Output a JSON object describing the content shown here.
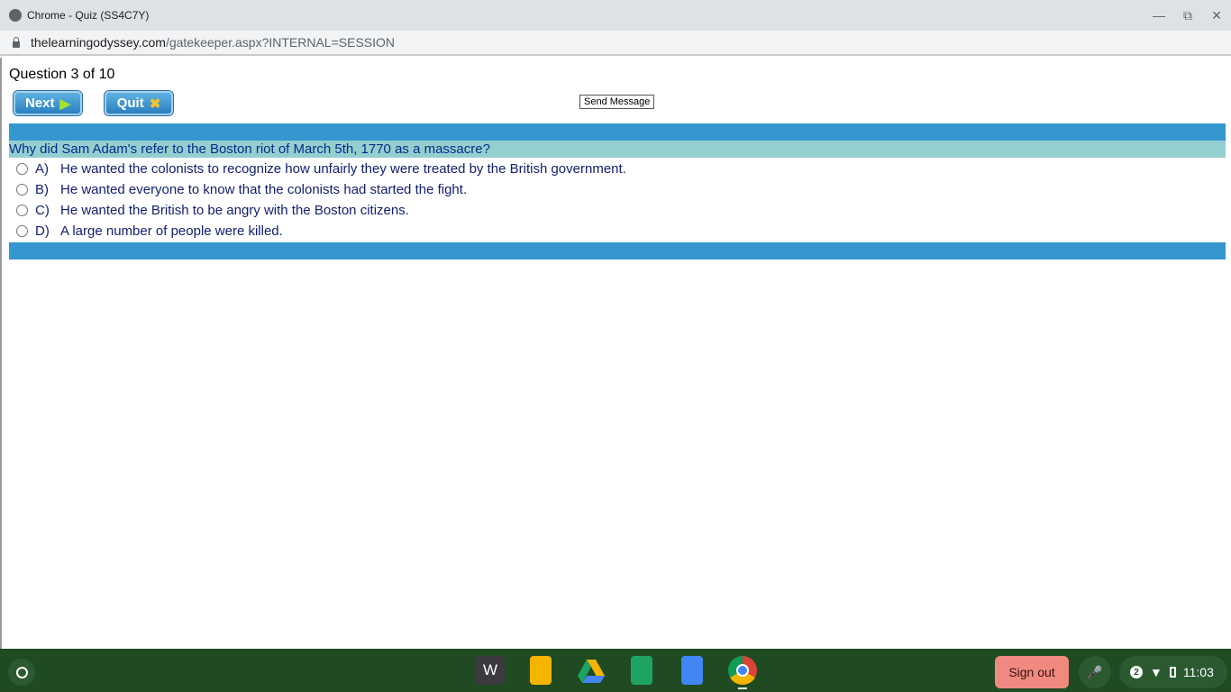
{
  "window": {
    "title": "Chrome - Quiz (SS4C7Y)",
    "minimize_icon": "minimize-icon",
    "restore_icon": "restore-icon",
    "close_icon": "close-icon"
  },
  "address": {
    "domain": "thelearningodyssey.com",
    "path": "/gatekeeper.aspx?INTERNAL=SESSION"
  },
  "quiz": {
    "progress": "Question 3 of 10",
    "next_label": "Next",
    "quit_label": "Quit",
    "send_message_label": "Send Message",
    "question": "Why did Sam Adam's refer to the Boston riot of March 5th, 1770 as a massacre?",
    "options": [
      {
        "letter": "A)",
        "text": "He wanted the colonists to recognize how unfairly they were treated by the British government."
      },
      {
        "letter": "B)",
        "text": "He wanted everyone to know that the colonists had started the fight."
      },
      {
        "letter": "C)",
        "text": "He wanted the British to be angry with the Boston citizens."
      },
      {
        "letter": "D)",
        "text": "A large number of people were killed."
      }
    ]
  },
  "shelf": {
    "apps": [
      "W",
      "slides-icon",
      "drive-icon",
      "sheets-icon",
      "docs-icon",
      "chrome-icon"
    ],
    "w_label": "W",
    "sign_out_label": "Sign out",
    "notification_count": "2",
    "time": "11:03"
  },
  "colors": {
    "band": "#3597cf",
    "question_bg": "#94cfd0",
    "shelf": "#1f4a22",
    "sign_out": "#f08a80"
  }
}
